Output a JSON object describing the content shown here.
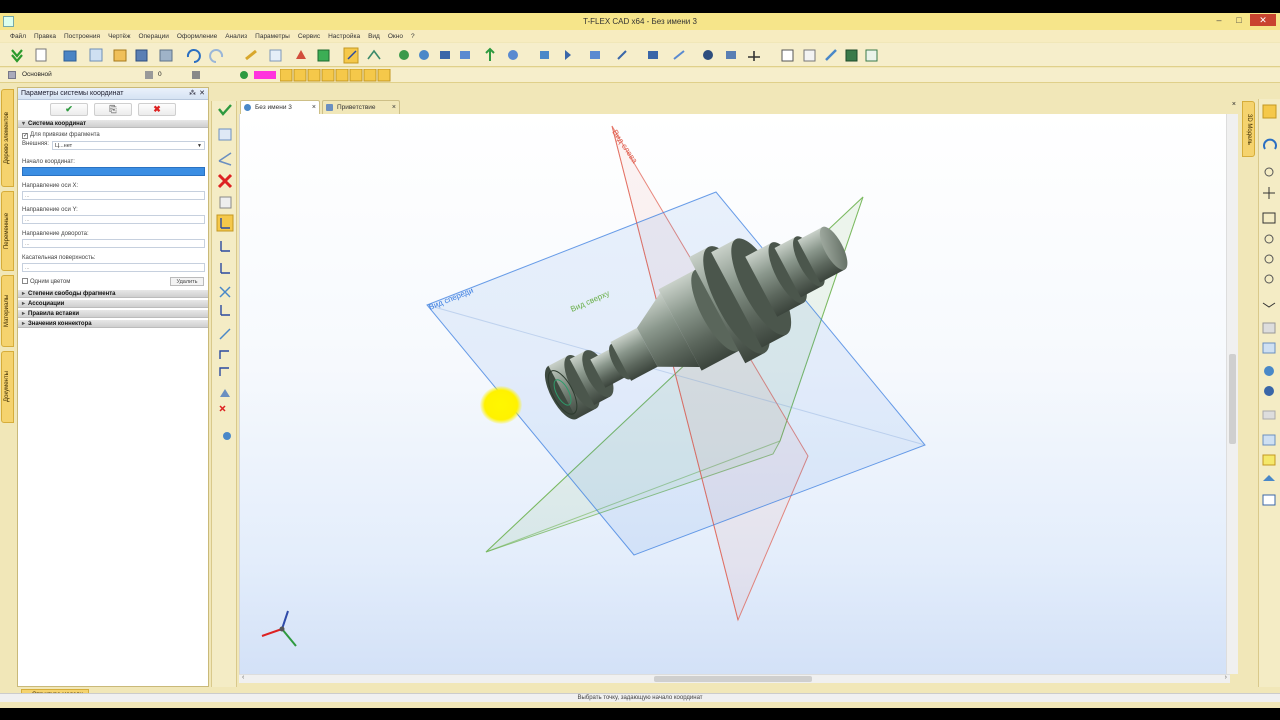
{
  "window": {
    "title": "T-FLEX CAD x64 - Без имени 3",
    "controls": [
      "–",
      "□",
      "✕"
    ]
  },
  "menu": [
    "Файл",
    "Правка",
    "Построения",
    "Чертёж",
    "Операции",
    "Оформление",
    "Анализ",
    "Параметры",
    "Сервис",
    "Настройка",
    "Вид",
    "Окно",
    "?"
  ],
  "toolbar2": {
    "layer": "Основной",
    "level": "0",
    "color": "#ff33dd"
  },
  "panel": {
    "title": "Параметры системы координат",
    "pin": "⁂",
    "close": "✕",
    "ok_label": "✔",
    "copy_label": "⎘",
    "cancel_label": "✖",
    "sections": {
      "coordinate_system": "Система координат",
      "freedom": "Степени свободы фрагмента",
      "associations": "Ассоциации",
      "insert_rules": "Правила вставки",
      "connector_values": "Значения коннектора"
    },
    "fragment_binding": "Для привязки фрагмента",
    "external_label": "Внешняя:",
    "external_value": "Ц...нет",
    "origin_label": "Начало координат:",
    "x_axis_label": "Направление оси X:",
    "x_axis_value": "...",
    "y_axis_label": "Направление оси Y:",
    "y_axis_value": "...",
    "rotation_label": "Направление доворота:",
    "rotation_value": "...",
    "tangent_label": "Касательная поверхность:",
    "tangent_value": "...",
    "one_color": "Одним цветом",
    "delete_label": "Удалить"
  },
  "left_tabs": [
    "Дерево элементов",
    "Переменные",
    "Материалы",
    "Документы"
  ],
  "doc_tabs": [
    {
      "label": "Без имени 3",
      "active": true
    },
    {
      "label": "Приветствие",
      "active": false
    }
  ],
  "right_tabs": [
    "3D Модель"
  ],
  "viewport": {
    "plane_front": "Вид спереди",
    "plane_left": "Вид слева",
    "plane_top": "Вид сверху",
    "colors": {
      "front": "#3a7de0",
      "left": "#e05a4a",
      "top": "#6ab04a",
      "part": "#6f7b72"
    }
  },
  "bottom_tab": "Структура модели",
  "status": "Выбрать точку, задающую начало координат"
}
